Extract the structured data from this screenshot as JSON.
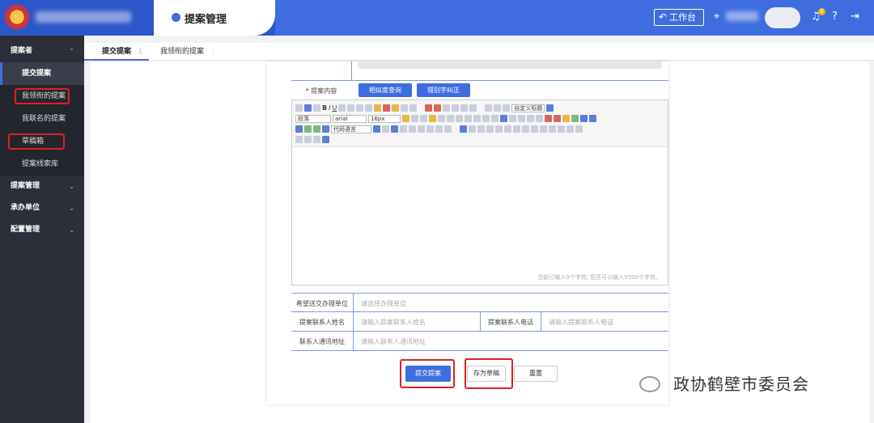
{
  "header": {
    "module_title": "提案管理",
    "workbench_label": "工作台",
    "notification_count": "0",
    "accent": "#3f6de0"
  },
  "sidebar": {
    "groups": [
      {
        "label": "提案者",
        "items": [
          "提交提案",
          "我领衔的提案",
          "我联名的提案",
          "草稿箱",
          "提案线索库"
        ]
      },
      {
        "label": "提案管理"
      },
      {
        "label": "承办单位"
      },
      {
        "label": "配置管理"
      }
    ]
  },
  "tabs": [
    "提交提案",
    "我领衔的提案"
  ],
  "form": {
    "content_label": "* 提案内容",
    "similarity_btn": "相似度查询",
    "typo_btn": "错别字纠正",
    "editor": {
      "style_sel": "段落",
      "font_sel": "arial",
      "size_sel": "16px",
      "custom_title": "自定义标题",
      "code_lang": "代码语言",
      "char_count": "当前已输入0个字符, 您还可以输入5500个字符。"
    },
    "fields": [
      {
        "label": "希望送交办理单位",
        "placeholder": "请选择办理单位"
      },
      {
        "label": "提案联系人姓名",
        "placeholder": "请输入提案联系人姓名"
      },
      {
        "label": "提案联系人电话",
        "placeholder": "请输入提案联系人电话"
      },
      {
        "label": "联系人通讯地址",
        "placeholder": "请输入联系人通讯地址"
      }
    ],
    "submit": "提交提案",
    "draft": "存为草稿",
    "reset": "重置"
  },
  "watermark": "政协鹤壁市委员会"
}
